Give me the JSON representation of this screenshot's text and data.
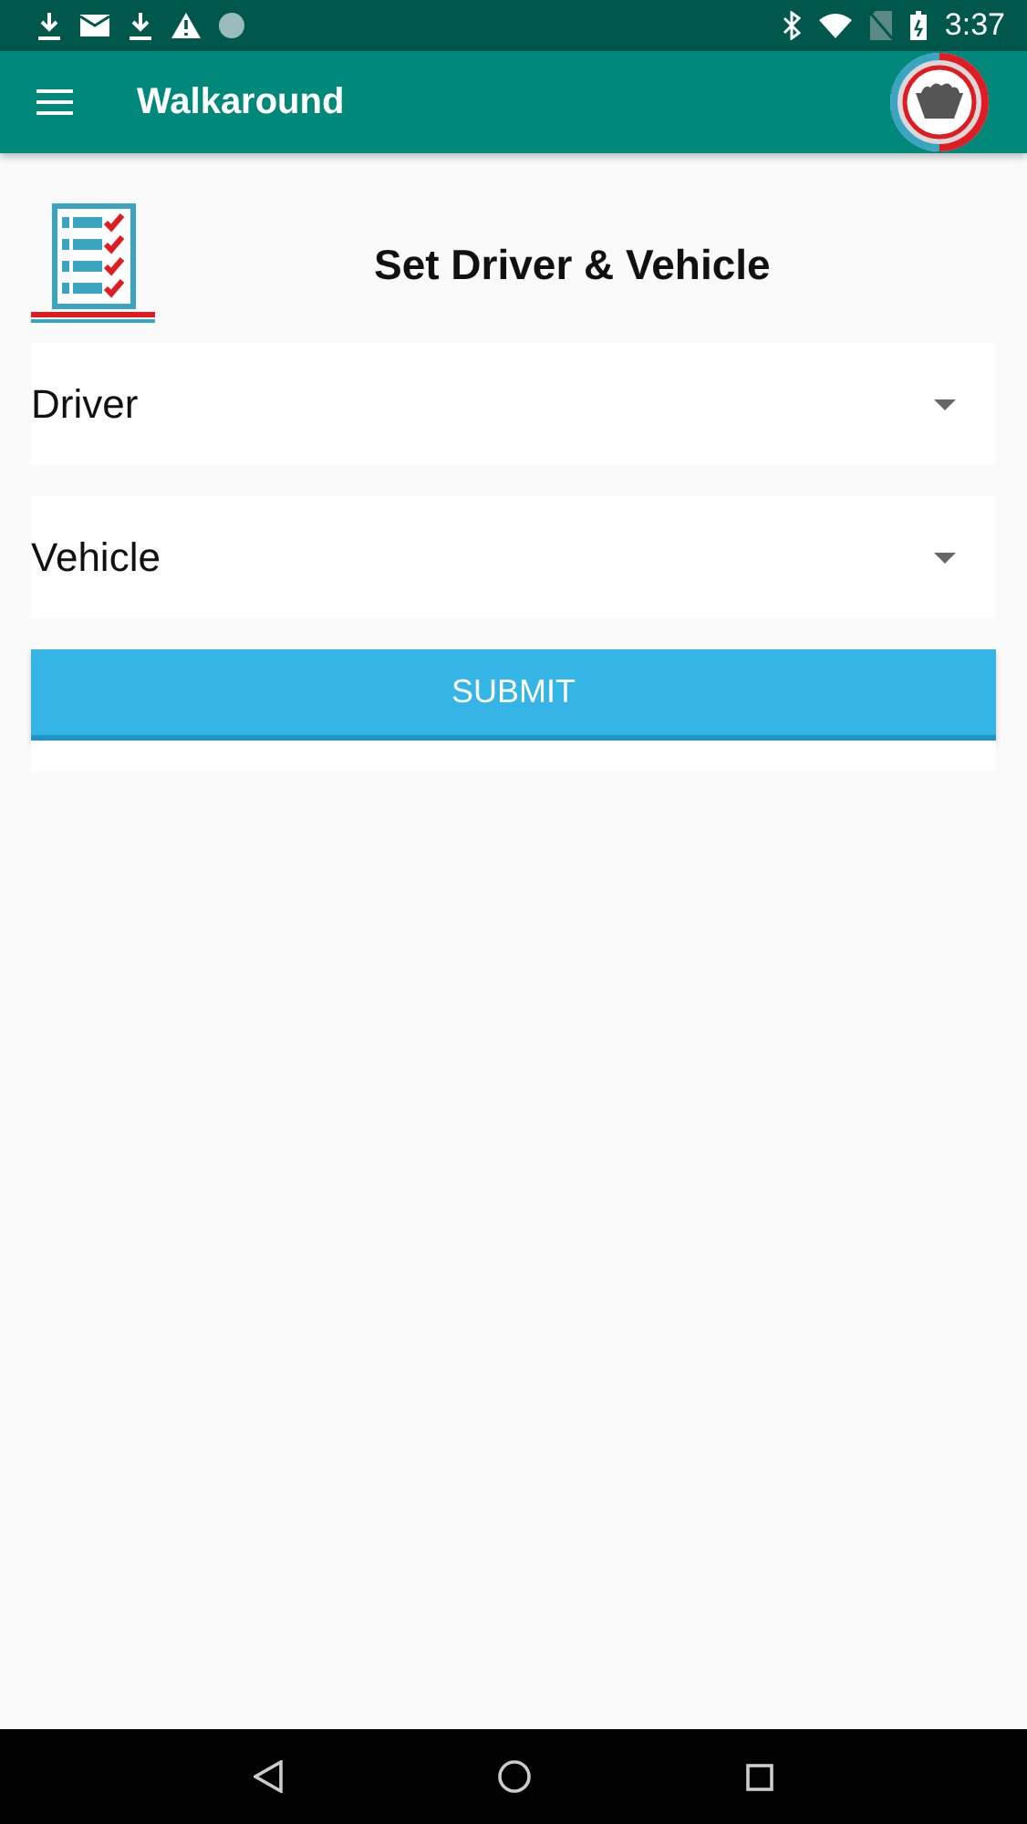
{
  "status_bar": {
    "time": "3:37"
  },
  "app_bar": {
    "title": "Walkaround"
  },
  "header": {
    "title": "Set Driver & Vehicle"
  },
  "dropdowns": [
    {
      "label": "Driver"
    },
    {
      "label": "Vehicle"
    }
  ],
  "submit_button": {
    "label": "SUBMIT"
  }
}
